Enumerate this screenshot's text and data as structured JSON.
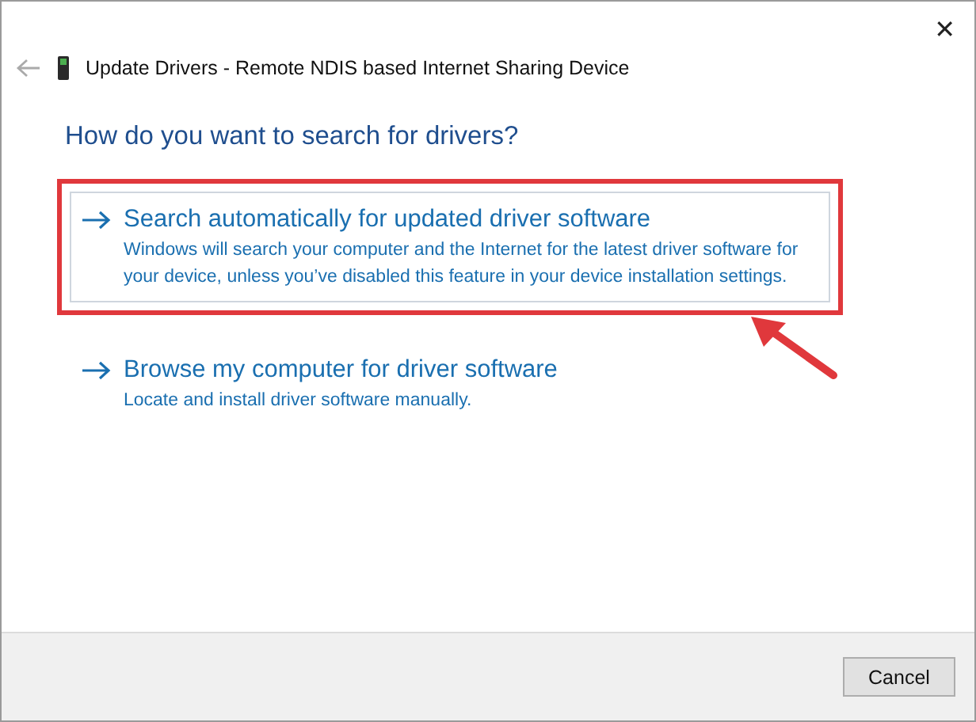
{
  "window": {
    "title": "Update Drivers - Remote NDIS based Internet Sharing Device",
    "close": "✕"
  },
  "heading": "How do you want to search for drivers?",
  "options": [
    {
      "title": "Search automatically for updated driver software",
      "description": "Windows will search your computer and the Internet for the latest driver software for your device, unless you’ve disabled this feature in your device installation settings.",
      "hovered": true,
      "highlighted": true
    },
    {
      "title": "Browse my computer for driver software",
      "description": "Locate and install driver software manually.",
      "hovered": false,
      "highlighted": false
    }
  ],
  "buttons": [
    "Cancel"
  ]
}
